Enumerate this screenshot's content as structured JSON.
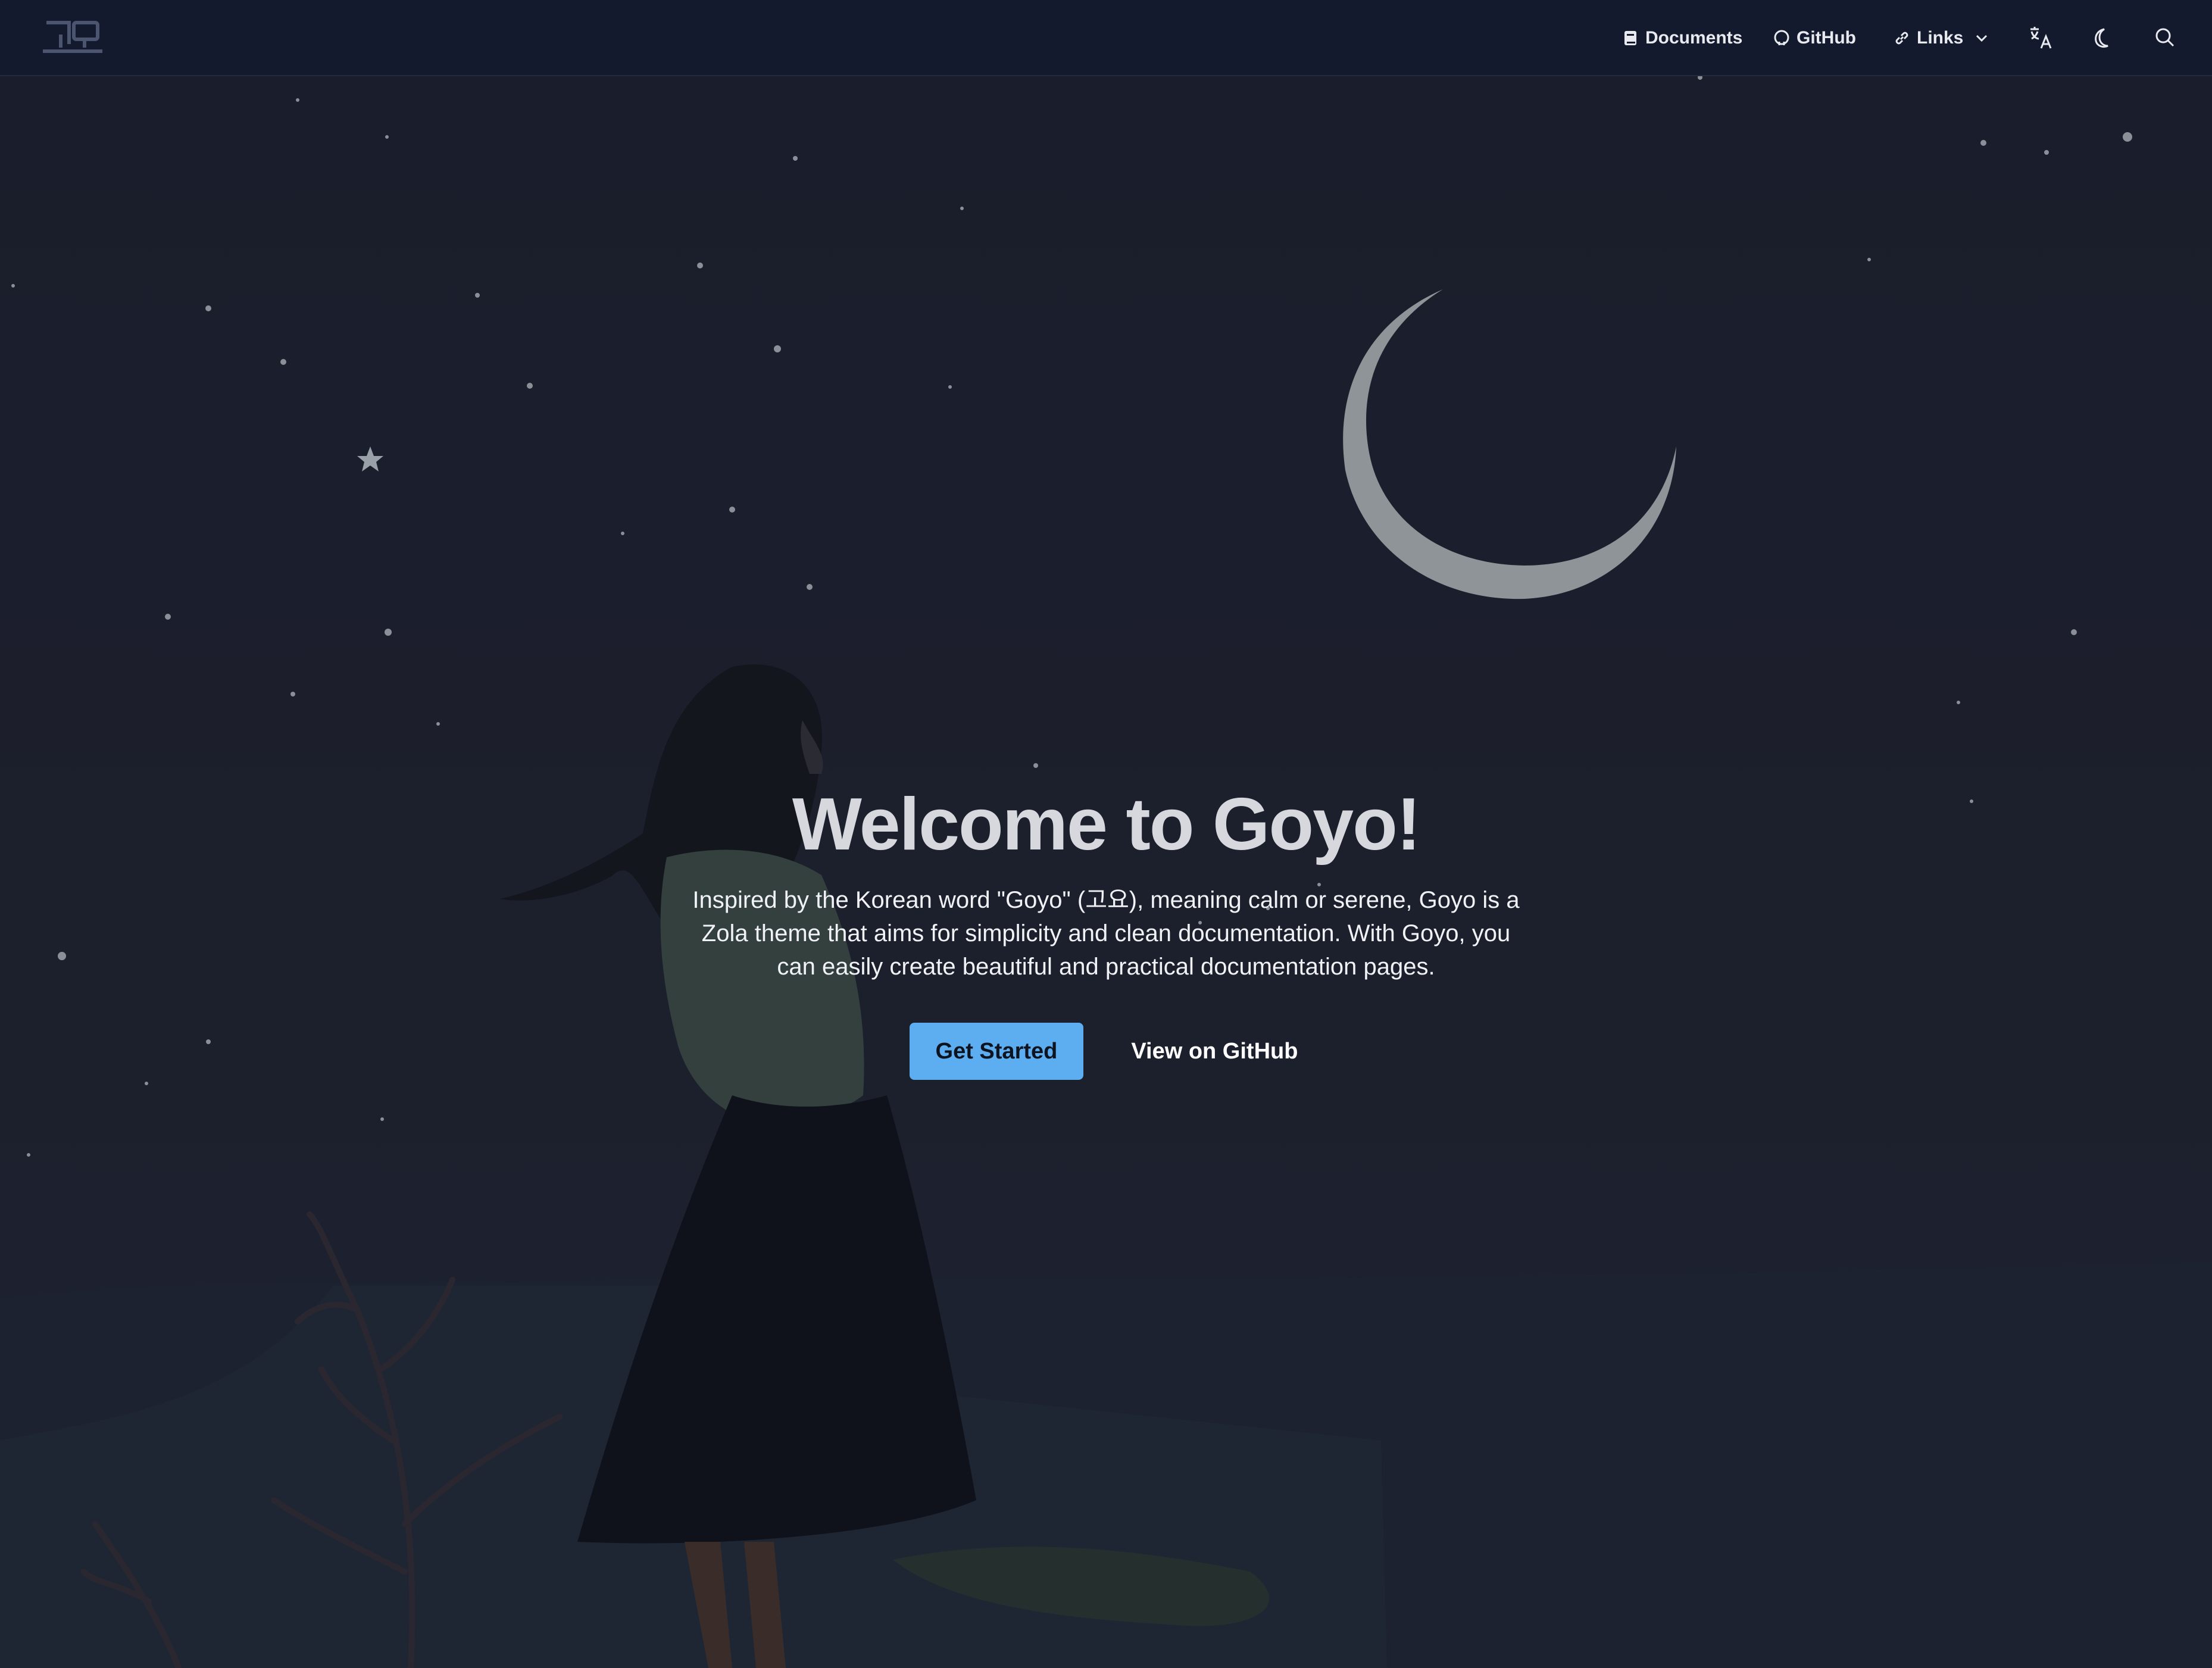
{
  "nav": {
    "documents_label": "Documents",
    "github_label": "GitHub",
    "links_label": "Links"
  },
  "hero": {
    "title": "Welcome to Goyo!",
    "description": "Inspired by the Korean word \"Goyo\" (고요), meaning calm or serene, Goyo is a Zola theme that aims for simplicity and clean documentation. With Goyo, you can easily create beautiful and practical documentation pages.",
    "primary_button": "Get Started",
    "secondary_button": "View on GitHub"
  },
  "colors": {
    "accent": "#5daef0",
    "navbar_bg": "#141a2e",
    "page_bg": "#1c1f2b"
  },
  "icons": {
    "logo": "goyo-logo",
    "documents": "book-icon",
    "github": "github-icon",
    "links": "link-icon",
    "dropdown": "chevron-down-icon",
    "language": "translate-icon",
    "theme": "moon-icon",
    "search": "search-icon"
  }
}
